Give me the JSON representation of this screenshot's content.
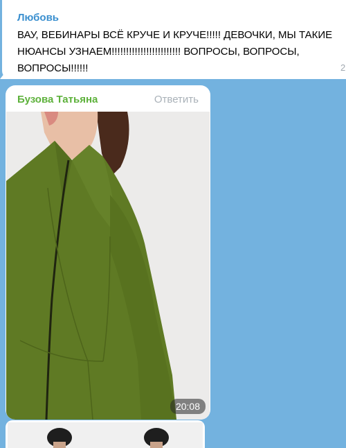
{
  "messages": [
    {
      "sender": "Любовь",
      "text": "ВАУ, ВЕБИНАРЫ ВСЁ КРУЧЕ И КРУЧЕ!!!!! ДЕВОЧКИ, МЫ ТАКИЕ НЮАНСЫ УЗНАЕМ!!!!!!!!!!!!!!!!!!!!!!!! ВОПРОСЫ, ВОПРОСЫ, ВОПРОСЫ!!!!!!",
      "time": "2",
      "sender_color": "#3a8fcf"
    },
    {
      "sender": "Бузова Татьяна",
      "reply_label": "Ответить",
      "photo_description_icon": "photo-green-coat",
      "time": "20:08",
      "sender_color": "#5db13b"
    }
  ],
  "colors": {
    "background": "#73b2df",
    "bubble": "#ffffff",
    "coat": "#5f7a24"
  }
}
